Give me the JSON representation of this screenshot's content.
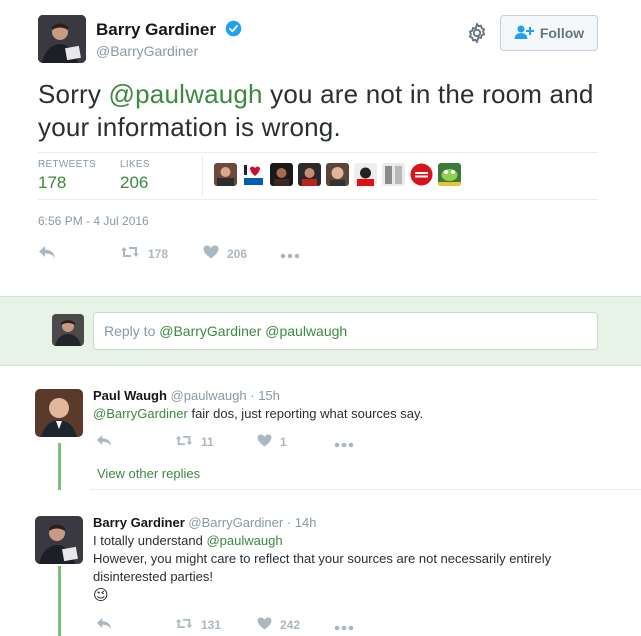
{
  "main_tweet": {
    "author_name": "Barry Gardiner",
    "author_handle": "@BarryGardiner",
    "follow_label": "Follow",
    "text_prefix": "Sorry ",
    "text_mention": "@paulwaugh",
    "text_suffix": " you are not in the room and your information is wrong.",
    "retweets_label": "RETWEETS",
    "retweets_count": "178",
    "likes_label": "LIKES",
    "likes_count": "206",
    "timestamp": "6:56 PM - 4 Jul 2016",
    "actions": {
      "retweet_count": "178",
      "like_count": "206"
    }
  },
  "reply_box": {
    "prefix": "Reply to ",
    "mentions": "@BarryGardiner @paulwaugh"
  },
  "replies": [
    {
      "name": "Paul Waugh",
      "handle": "@paulwaugh",
      "time": "· 15h",
      "mention": "@BarryGardiner",
      "text": " fair dos, just reporting what sources say.",
      "retweets": "11",
      "likes": "1"
    },
    {
      "name": "Barry Gardiner",
      "handle": "@BarryGardiner",
      "time": "· 14h",
      "line1_prefix": "I totally understand ",
      "line1_mention": "@paulwaugh",
      "line2": "However, you might care to reflect that your sources are not necessarily entirely disinterested parties!",
      "emoji": "😉",
      "retweets": "131",
      "likes": "242"
    }
  ],
  "view_other_replies": "View other replies",
  "colors": {
    "accent_green": "#3b8a3e",
    "reply_bg": "#e8f3e8",
    "thread_line": "#7cc07c",
    "muted": "#8899a6",
    "verified_blue": "#1da1f2"
  }
}
